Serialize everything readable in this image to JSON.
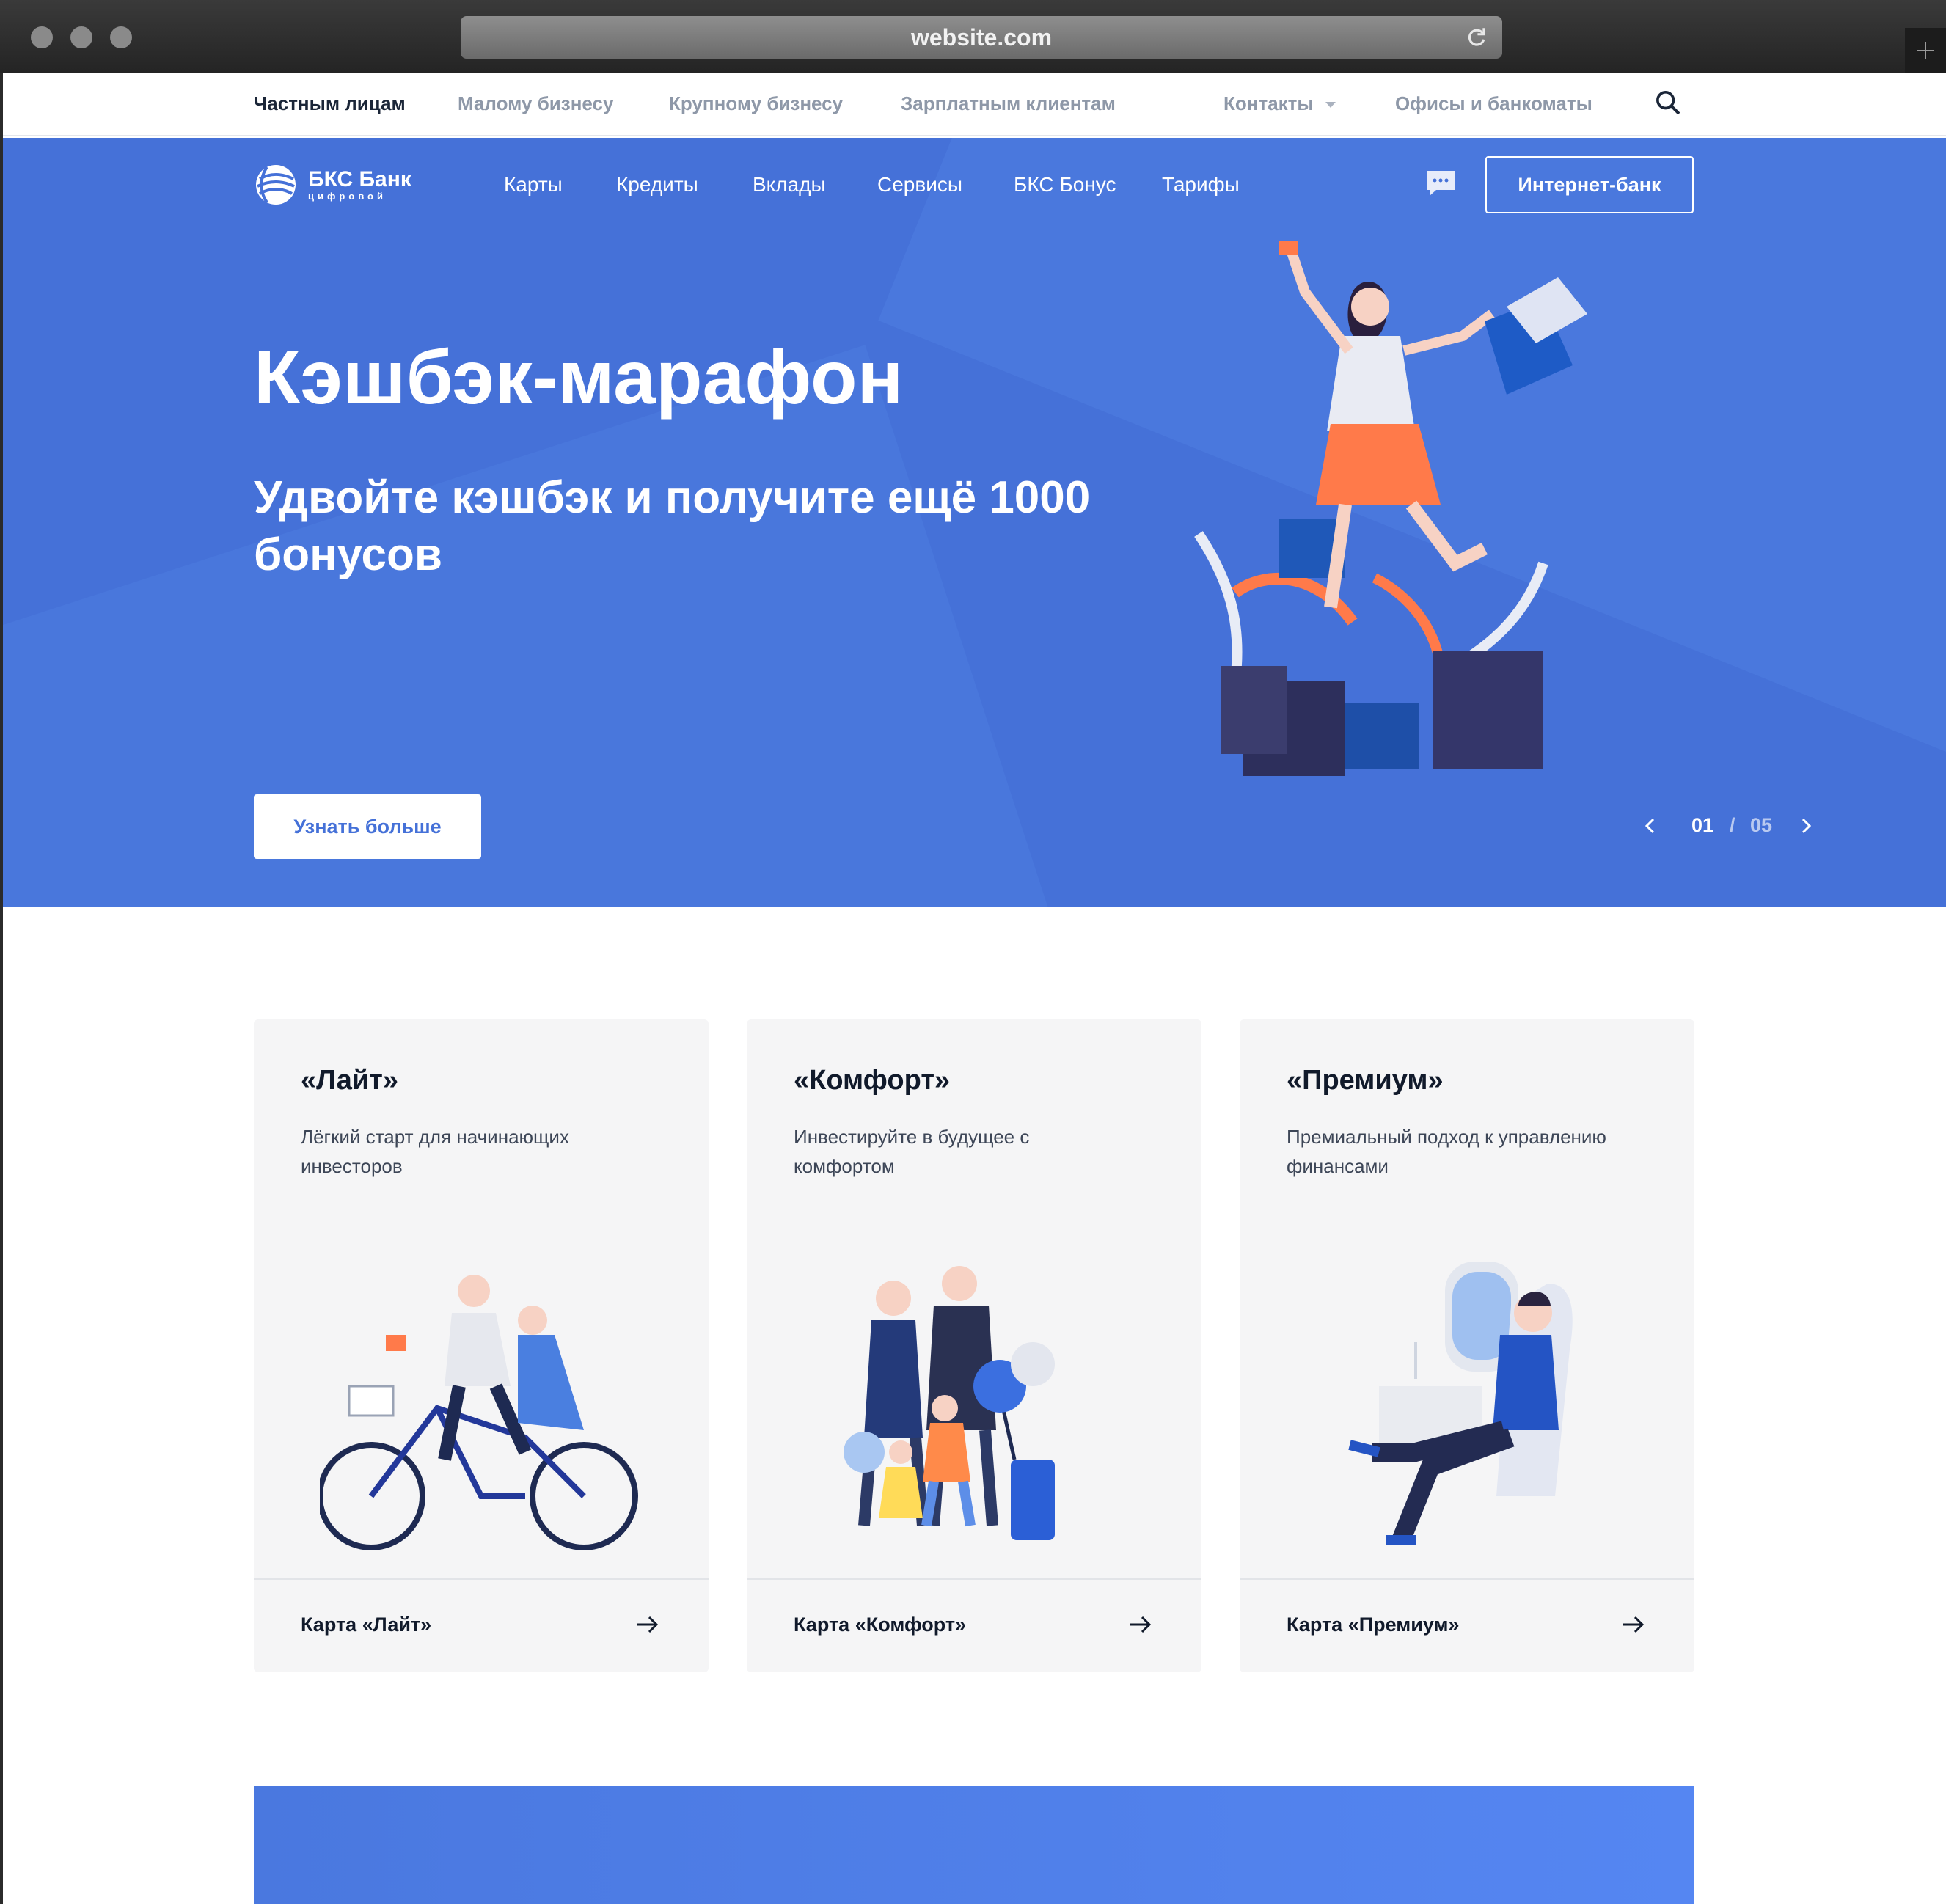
{
  "browser": {
    "url": "website.com"
  },
  "topnav": {
    "items": [
      "Частным лицам",
      "Малому бизнесу",
      "Крупному бизнесу",
      "Зарплатным клиентам"
    ],
    "contacts": "Контакты",
    "offices": "Офисы и банкоматы"
  },
  "brand": {
    "name": "БКС Банк",
    "sub": "цифровой",
    "color": "#4571d8"
  },
  "mainnav": {
    "items": [
      "Карты",
      "Кредиты",
      "Вклады",
      "Сервисы",
      "БКС Бонус",
      "Тарифы"
    ],
    "internet_bank": "Интернет-банк"
  },
  "hero": {
    "title": "Кэшбэк-марафон",
    "subtitle": "Удвойте кэшбэк и получите ещё 1000 бонусов",
    "cta": "Узнать больше",
    "slide_current": "01",
    "slide_sep": "/",
    "slide_total": "05"
  },
  "cards": [
    {
      "title": "«Лайт»",
      "desc": "Лёгкий старт для начинающих инвесторов",
      "link": "Карта «Лайт»"
    },
    {
      "title": "«Комфорт»",
      "desc": "Инвестируйте в будущее с комфортом",
      "link": "Карта «Комфорт»"
    },
    {
      "title": "«Премиум»",
      "desc": "Премиальный подход к управлению финансами",
      "link": "Карта «Премиум»"
    }
  ],
  "icons": [
    "search-icon",
    "chevron-down-icon",
    "chat-icon",
    "chevron-left-icon",
    "chevron-right-icon",
    "arrow-right-icon",
    "reload-icon",
    "plus-icon"
  ]
}
